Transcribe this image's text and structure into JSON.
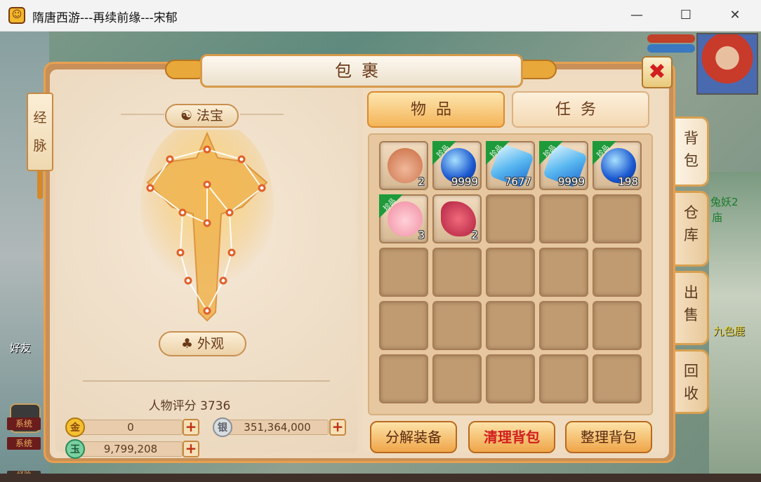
{
  "window": {
    "title": "隋唐西游---再续前缘---宋郁",
    "minimize": "—",
    "maximize": "☐",
    "close": "✕"
  },
  "panel": {
    "title": "包裹",
    "close_icon": "✖"
  },
  "left": {
    "jingmai": "经脉",
    "fabao": "法宝",
    "waiguan": "外观",
    "score_label": "人物评分",
    "score_value": "3736"
  },
  "currency": {
    "gold": "0",
    "silver": "351,364,000",
    "jade": "9,799,208"
  },
  "tabs": {
    "items": "物品",
    "tasks": "任务"
  },
  "side_tabs": [
    "背包",
    "仓库",
    "出售",
    "回收"
  ],
  "inventory": [
    {
      "icon": "fortune-bag-icon",
      "qty": "2",
      "rare": false
    },
    {
      "icon": "blue-orb-icon",
      "qty": "9999",
      "rare": true
    },
    {
      "icon": "blue-crystal-icon",
      "qty": "7677",
      "rare": true
    },
    {
      "icon": "blue-crystal-icon",
      "qty": "9999",
      "rare": true
    },
    {
      "icon": "blue-orb-icon",
      "qty": "198",
      "rare": true
    },
    {
      "icon": "pig-pet-icon",
      "qty": "3",
      "rare": true
    },
    {
      "icon": "seahorse-icon",
      "qty": "2",
      "rare": false
    }
  ],
  "rare_label": "珍品",
  "buttons": {
    "decompose": "分解装备",
    "clear": "清理背包",
    "sort": "整理背包"
  },
  "game_bg": {
    "friend": "好友",
    "system1": "系统",
    "system2": "系统",
    "exp": "经验",
    "right_name": "九色鹿",
    "right_text1": "兔妖2",
    "right_text2": "庙"
  },
  "colors": {
    "panel_frame": "#c89058",
    "rare_tag": "#1e9a3a",
    "clear_text": "#d21e1e"
  }
}
